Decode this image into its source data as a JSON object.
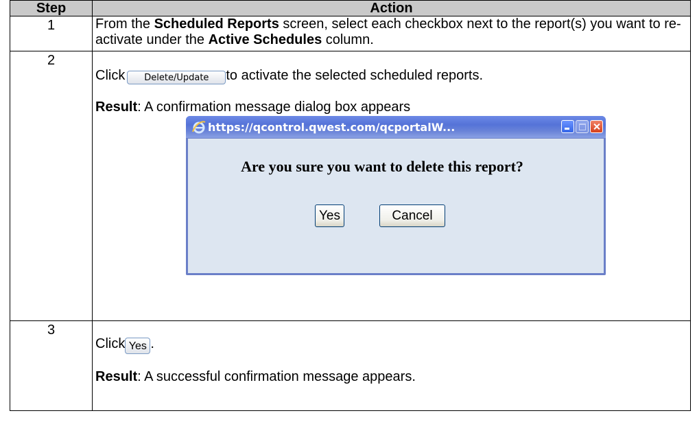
{
  "table": {
    "headers": {
      "step": "Step",
      "action": "Action"
    },
    "rows": [
      {
        "step": "1",
        "text_1": "From the ",
        "bold_1": "Scheduled Reports",
        "text_2": " screen, select each checkbox next to the report(s) you want to re-activate under the ",
        "bold_2": "Active Schedules",
        "text_3": " column."
      },
      {
        "step": "2",
        "click_prefix": "Click",
        "button_label": "Delete/Update",
        "click_suffix": "to activate the selected scheduled reports.",
        "result_label": "Result",
        "result_text": ":  A confirmation message dialog box appears",
        "dialog": {
          "title": "https://qcontrol.qwest.com/qcportalW...",
          "message": "Are you sure you want to delete this report?",
          "yes_label": "Yes",
          "cancel_label": "Cancel",
          "title_bar_color": "#5573d8",
          "body_color": "#dde6f1"
        }
      },
      {
        "step": "3",
        "click_prefix": "Click",
        "button_label": "Yes",
        "click_suffix": ".",
        "result_label": "Result",
        "result_text": ":  A successful confirmation message appears."
      }
    ]
  },
  "icons": {
    "ie": "internet-explorer-icon",
    "minimize": "minimize-icon",
    "maximize": "maximize-icon",
    "close": "close-icon"
  },
  "colors": {
    "header_background": "#c9c9c9",
    "border": "#000000"
  }
}
